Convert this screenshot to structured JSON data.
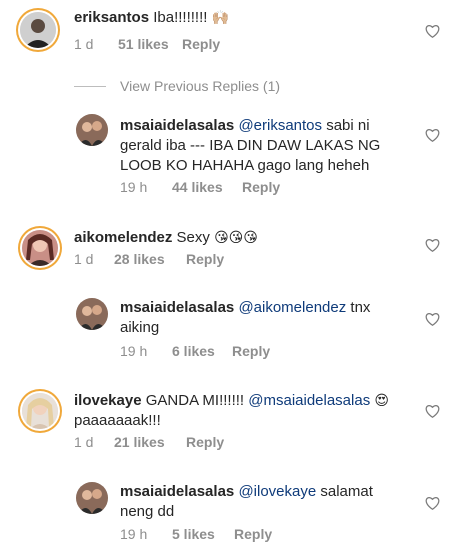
{
  "comments": [
    {
      "user": "eriksantos",
      "text": " Iba!!!!!!!!",
      "emoji": "🙌🏼",
      "time": "1 d",
      "likes": "51 likes",
      "reply": "Reply"
    },
    {
      "user": "msaiaidelasalas",
      "mention": "@eriksantos",
      "text_line1_rest": " sabi ni",
      "text_line2": "gerald iba --- IBA DIN DAW LAKAS NG",
      "text_line3": "LOOB KO HAHAHA gago lang heheh",
      "time": "19 h",
      "likes": "44 likes",
      "reply": "Reply"
    },
    {
      "user": "aikomelendez",
      "text": " Sexy ",
      "emoji": "😘😘😘",
      "time": "1 d",
      "likes": "28 likes",
      "reply": "Reply"
    },
    {
      "user": "msaiaidelasalas",
      "mention": "@aikomelendez",
      "text_line1_rest": " tnx",
      "text_line2": "aiking",
      "time": "19 h",
      "likes": "6 likes",
      "reply": "Reply"
    },
    {
      "user": "ilovekaye",
      "text": " GANDA MI!!!!!! ",
      "mention": "@msaiaidelasalas",
      "emoji": "😍",
      "text_line2": "paaaaaaak!!!",
      "time": "1 d",
      "likes": "21 likes",
      "reply": "Reply"
    },
    {
      "user": "msaiaidelasalas",
      "mention": "@ilovekaye",
      "text_line1_rest": " salamat",
      "text_line2": "neng dd",
      "time": "19 h",
      "likes": "5 likes",
      "reply": "Reply"
    }
  ],
  "view_previous": "View Previous Replies (1)",
  "icons": {
    "like": "heart-outline-icon"
  },
  "colors": {
    "ring": "#f0a83a",
    "mention": "#0f3b7a",
    "meta": "#8e8e8e"
  }
}
